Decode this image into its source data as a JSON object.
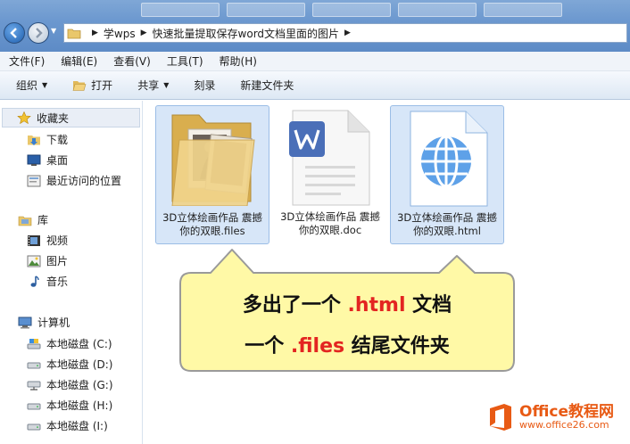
{
  "address": {
    "crumbs": [
      "学wps",
      "快速批量提取保存word文档里面的图片"
    ]
  },
  "menu": [
    "文件(F)",
    "编辑(E)",
    "查看(V)",
    "工具(T)",
    "帮助(H)"
  ],
  "toolbar": {
    "organize": "组织",
    "open": "打开",
    "share": "共享",
    "burn": "刻录",
    "new_folder": "新建文件夹"
  },
  "nav": {
    "favorites": "收藏夹",
    "downloads": "下载",
    "desktop": "桌面",
    "recent": "最近访问的位置",
    "libraries": "库",
    "videos": "视频",
    "pictures": "图片",
    "music": "音乐",
    "computer": "计算机",
    "drives": [
      "本地磁盘 (C:)",
      "本地磁盘 (D:)",
      "本地磁盘 (G:)",
      "本地磁盘 (H:)",
      "本地磁盘 (I:)"
    ]
  },
  "files": [
    {
      "line1": "3D立体绘画作品 震撼",
      "line2": "你的双眼.files"
    },
    {
      "line1": "3D立体绘画作品 震撼",
      "line2": "你的双眼.doc"
    },
    {
      "line1": "3D立体绘画作品 震撼",
      "line2": "你的双眼.html"
    }
  ],
  "callout": {
    "line1_pre": "多出了一个 ",
    "line1_hl": ".html",
    "line1_post": " 文档",
    "line2_pre": "一个 ",
    "line2_hl": ".files",
    "line2_post": " 结尾文件夹"
  },
  "logo": {
    "name": "Office教程网",
    "url": "www.office26.com"
  },
  "colors": {
    "callout_fill": "#fff9a6",
    "callout_border": "#9a9a9a",
    "highlight": "#e32521",
    "selection": "#d7e6f8",
    "brand": "#e85a14"
  }
}
